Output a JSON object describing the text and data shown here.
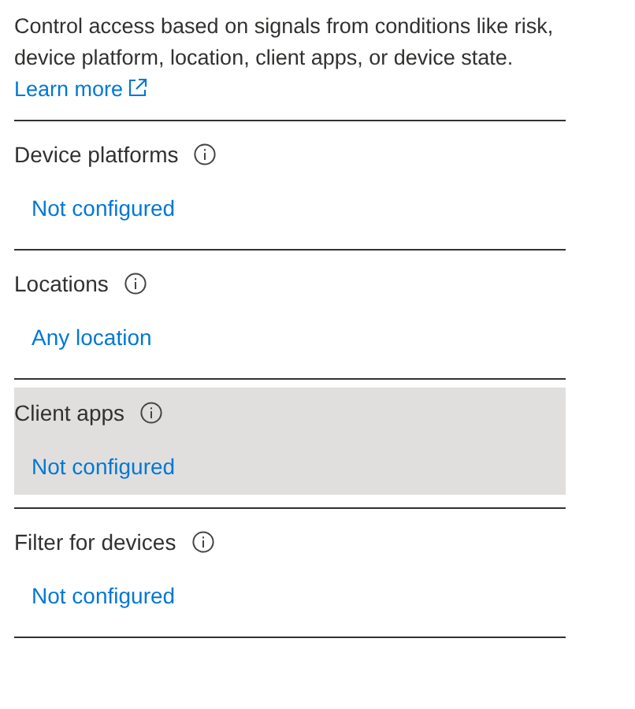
{
  "description": {
    "text": "Control access based on signals from conditions like risk, device platform, location, client apps, or device state.",
    "link": "Learn more"
  },
  "conditions": [
    {
      "label": "Device platforms",
      "value": "Not configured",
      "hovered": false
    },
    {
      "label": "Locations",
      "value": "Any location",
      "hovered": false
    },
    {
      "label": "Client apps",
      "value": "Not configured",
      "hovered": true
    },
    {
      "label": "Filter for devices",
      "value": "Not configured",
      "hovered": false
    }
  ]
}
